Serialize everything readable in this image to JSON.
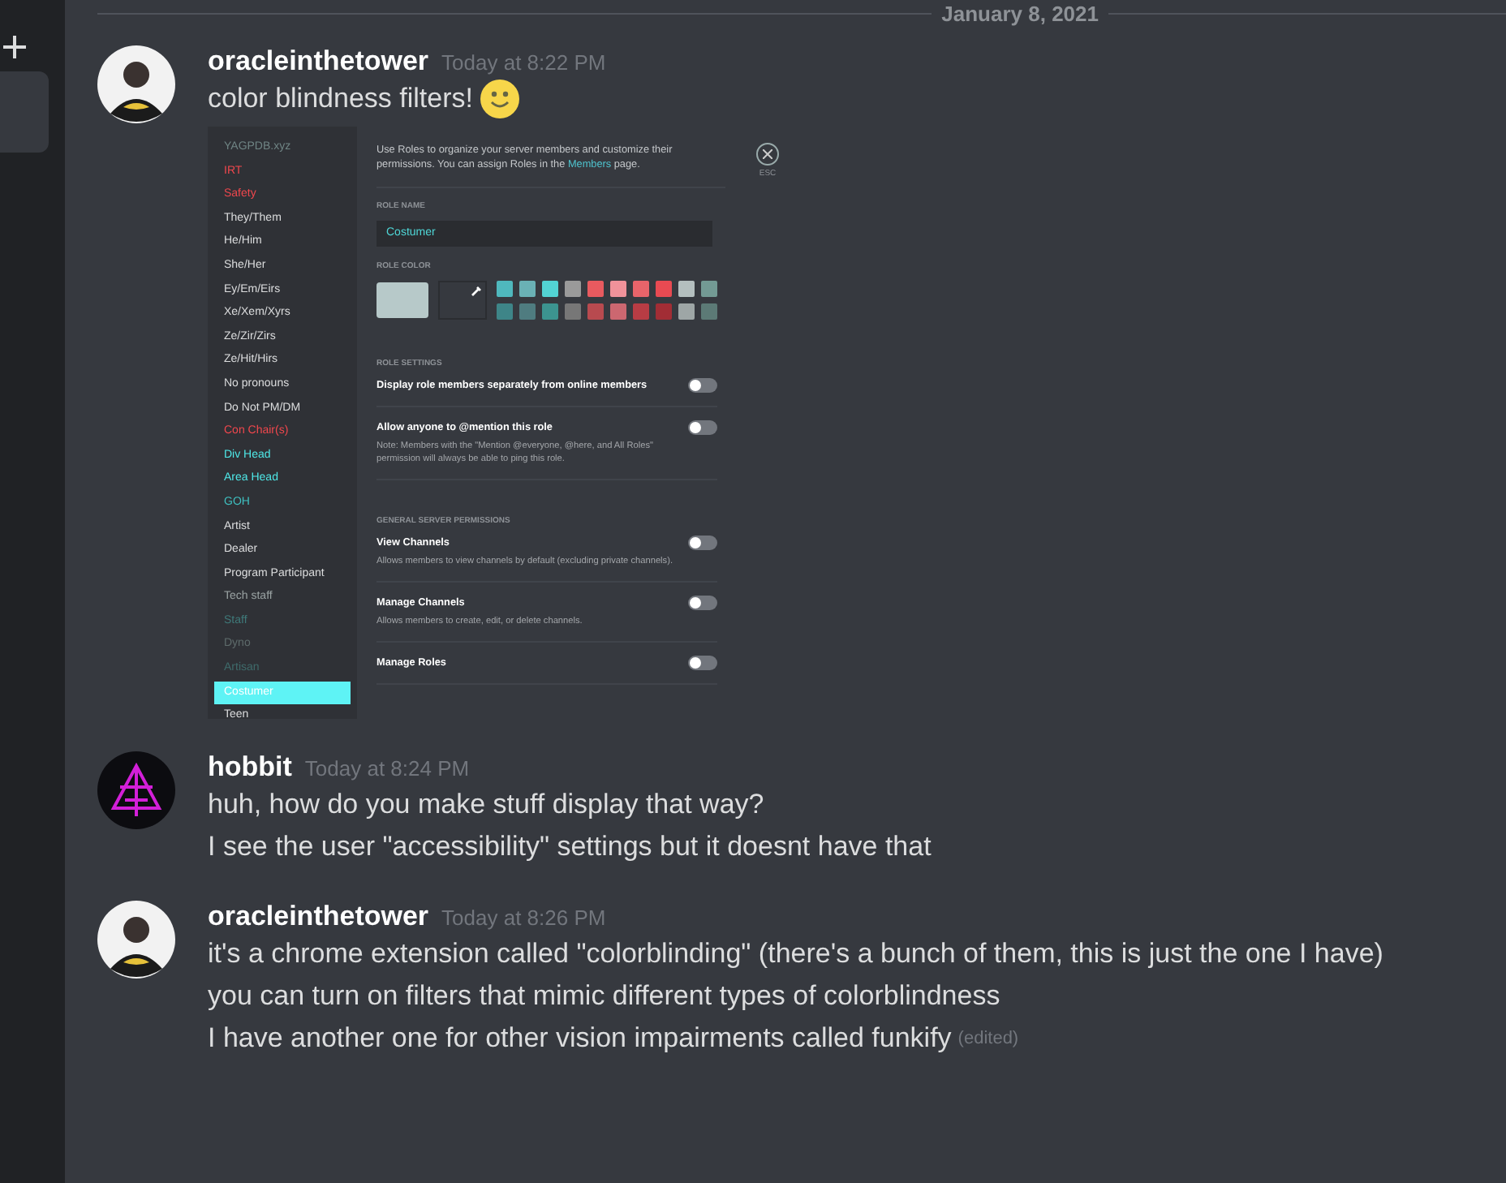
{
  "date_divider": "January 8, 2021",
  "messages": [
    {
      "author": "oracleinthetower",
      "timestamp": "Today at 8:22 PM",
      "avatar": {
        "kind": "person"
      },
      "lines": [
        "color blindness filters!"
      ],
      "emoji": {
        "kind": "smile"
      },
      "attachment": {
        "roles": [
          {
            "name": "YAGPDB.xyz",
            "color": "#6f8484",
            "selected": false
          },
          {
            "name": "IRT",
            "color": "#f0474d",
            "selected": false
          },
          {
            "name": "Safety",
            "color": "#f0474d",
            "selected": false
          },
          {
            "name": "They/Them",
            "color": "#dcddde",
            "selected": false
          },
          {
            "name": "He/Him",
            "color": "#dcddde",
            "selected": false
          },
          {
            "name": "She/Her",
            "color": "#dcddde",
            "selected": false
          },
          {
            "name": "Ey/Em/Eirs",
            "color": "#dcddde",
            "selected": false
          },
          {
            "name": "Xe/Xem/Xyrs",
            "color": "#dcddde",
            "selected": false
          },
          {
            "name": "Ze/Zir/Zirs",
            "color": "#dcddde",
            "selected": false
          },
          {
            "name": "Ze/Hit/Hirs",
            "color": "#dcddde",
            "selected": false
          },
          {
            "name": "No pronouns",
            "color": "#dcddde",
            "selected": false
          },
          {
            "name": "Do Not PM/DM",
            "color": "#dcddde",
            "selected": false
          },
          {
            "name": "Con Chair(s)",
            "color": "#f0474d",
            "selected": false
          },
          {
            "name": "Div Head",
            "color": "#4fe8e8",
            "selected": false
          },
          {
            "name": "Area Head",
            "color": "#4fe8e8",
            "selected": false
          },
          {
            "name": "GOH",
            "color": "#3fc0c0",
            "selected": false
          },
          {
            "name": "Artist",
            "color": "#dcddde",
            "selected": false
          },
          {
            "name": "Dealer",
            "color": "#dcddde",
            "selected": false
          },
          {
            "name": "Program Participant",
            "color": "#dcddde",
            "selected": false
          },
          {
            "name": "Tech staff",
            "color": "#9aa3a3",
            "selected": false
          },
          {
            "name": "Staff",
            "color": "#3f7a7a",
            "selected": false
          },
          {
            "name": "Dyno",
            "color": "#5e6b6b",
            "selected": false
          },
          {
            "name": "Artisan",
            "color": "#3f6b6b",
            "selected": false
          },
          {
            "name": "Costumer",
            "color": "#5ef3f5",
            "selected": true
          },
          {
            "name": "Teen",
            "color": "#dcddde",
            "selected": false
          }
        ],
        "intro": "Use Roles to organize your server members and customize their permissions. You can assign Roles in the",
        "intro_link": "Members",
        "intro_end": "page.",
        "close_label": "ESC",
        "role_name_label": "ROLE NAME",
        "role_name": "Costumer",
        "role_color_label": "ROLE COLOR",
        "current_swatch": {
          "color": "#b7c9c9"
        },
        "swatches": [
          {
            "color": "#4fb8bd"
          },
          {
            "color": "#6ab1b5"
          },
          {
            "color": "#52d3d3"
          },
          {
            "color": "#9a9a9a"
          },
          {
            "color": "#e85a5f"
          },
          {
            "color": "#f0929a"
          },
          {
            "color": "#e8646a"
          },
          {
            "color": "#e84a52"
          },
          {
            "color": "#b4bfbf"
          },
          {
            "color": "#739a94"
          },
          {
            "color": "#3e8588"
          },
          {
            "color": "#4f7c80"
          },
          {
            "color": "#3c9490"
          },
          {
            "color": "#777777"
          },
          {
            "color": "#b84a4f"
          },
          {
            "color": "#cc6770"
          },
          {
            "color": "#b83c44"
          },
          {
            "color": "#a22d35"
          },
          {
            "color": "#9ea6a6"
          },
          {
            "color": "#5c7a76"
          }
        ],
        "role_settings_label": "ROLE SETTINGS",
        "settings": [
          {
            "title": "Display role members separately from online members",
            "on": false
          },
          {
            "title": "Allow anyone to @mention this role",
            "note": "Note: Members with the \"Mention @everyone, @here, and All Roles\" permission will always be able to ping this role.",
            "on": false
          }
        ],
        "permissions_label": "GENERAL SERVER PERMISSIONS",
        "permissions": [
          {
            "title": "View Channels",
            "note": "Allows members to view channels by default (excluding private channels).",
            "on": false
          },
          {
            "title": "Manage Channels",
            "note": "Allows members to create, edit, or delete channels.",
            "on": false
          },
          {
            "title": "Manage Roles",
            "on": false
          }
        ]
      }
    },
    {
      "author": "hobbit",
      "timestamp": "Today at 8:24 PM",
      "avatar": {
        "kind": "sigil"
      },
      "lines": [
        "huh, how do you make stuff display that way?",
        "I see the user \"accessibility\" settings but it doesnt have that"
      ]
    },
    {
      "author": "oracleinthetower",
      "timestamp": "Today at 8:26 PM",
      "avatar": {
        "kind": "person"
      },
      "lines": [
        "it's a chrome extension called \"colorblinding\" (there's a bunch of them, this is just the one I have)",
        "you can turn on filters that mimic different types of colorblindness",
        "I have another one for other vision impairments called funkify"
      ],
      "edited_label": "(edited)"
    }
  ]
}
